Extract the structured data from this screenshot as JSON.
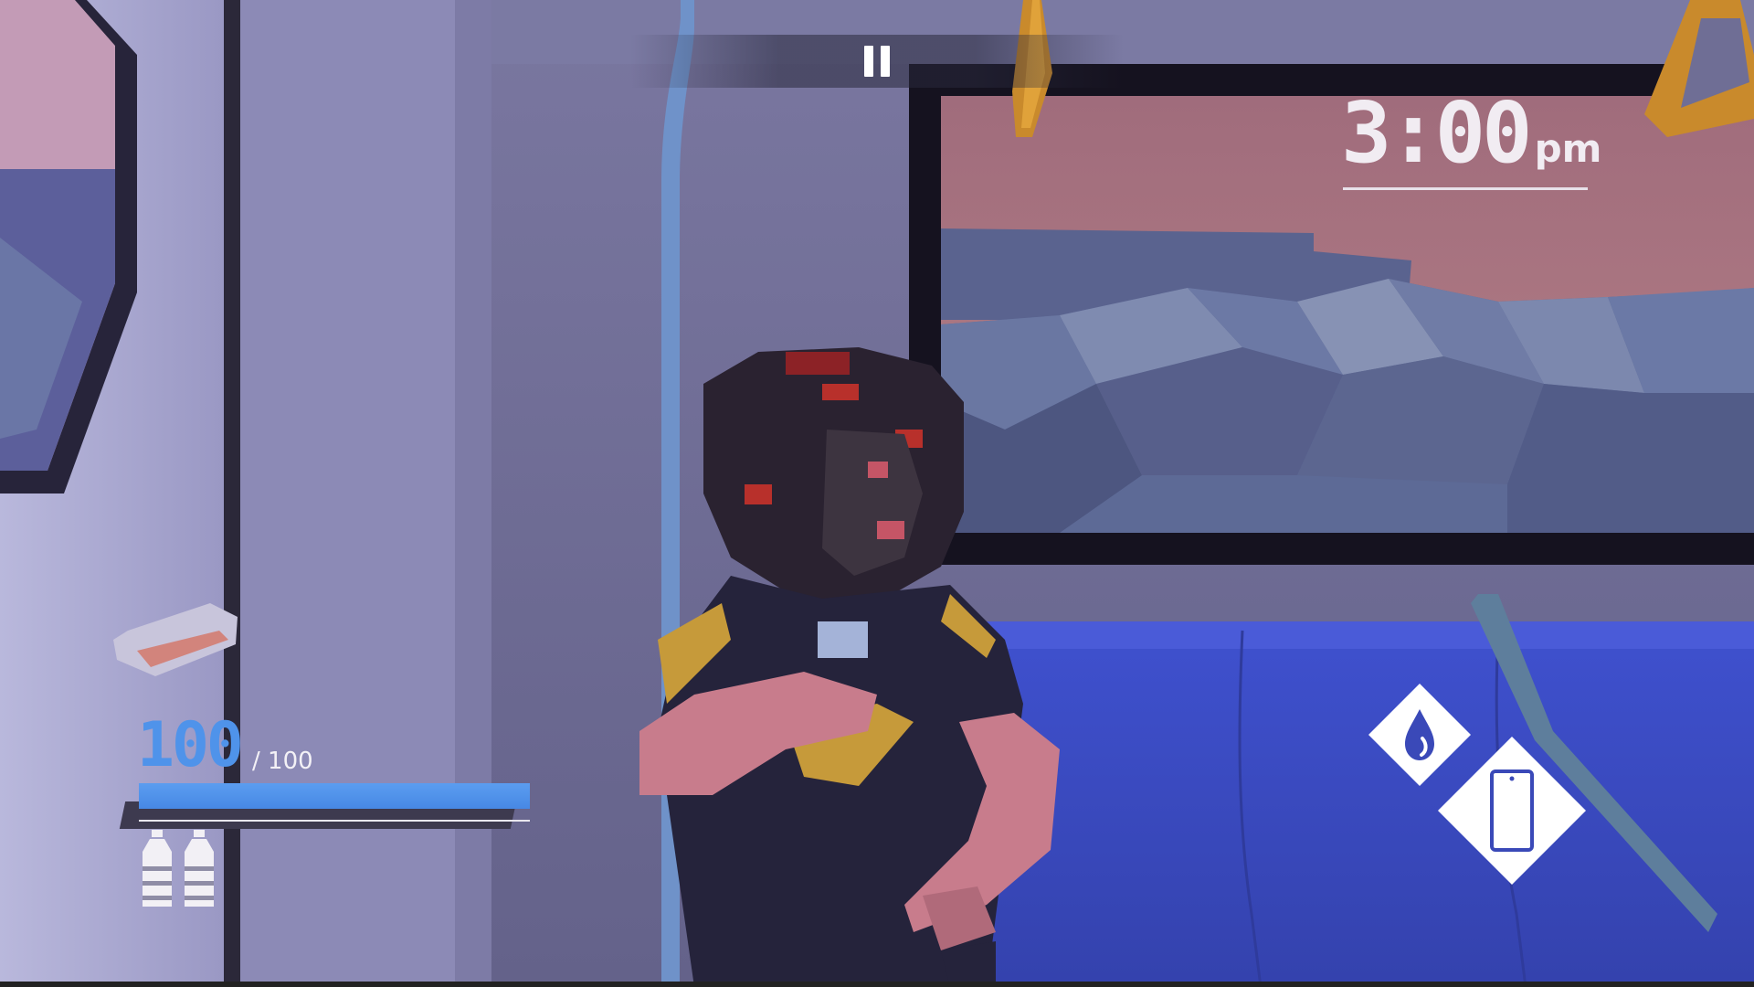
{
  "hud": {
    "clock": {
      "time": "3:00",
      "ampm": "pm"
    },
    "health": {
      "current": "100",
      "max": "/ 100",
      "fraction": 1.0
    },
    "water_bottles": 2,
    "pause": {
      "icon": "pause-icon"
    },
    "actions": [
      {
        "name": "drink-water-button",
        "icon": "water-drop-icon"
      },
      {
        "name": "phone-button",
        "icon": "phone-icon"
      }
    ]
  },
  "colors": {
    "health_text": "#4f93ea",
    "health_bar": "#4f93ea",
    "clock_text": "#f1ecf2",
    "seat": "#3b4cc8",
    "handle": "#c98a2c",
    "wall": "#6f6e95"
  }
}
